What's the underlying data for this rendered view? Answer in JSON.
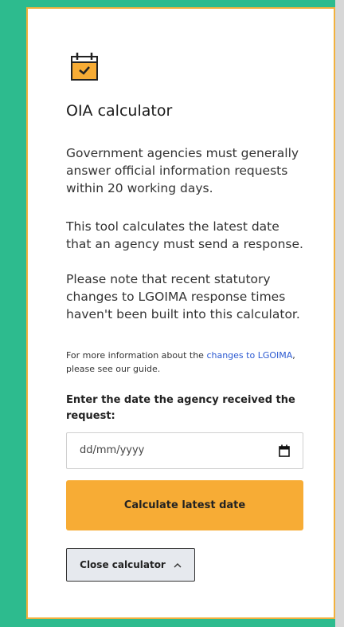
{
  "theme": {
    "background": "#2dbb8e",
    "card_border": "#f2b13d",
    "accent": "#f7ac35",
    "link": "#2b59d1"
  },
  "card": {
    "icon": "calendar-check-icon",
    "title": "OIA calculator",
    "paragraphs": [
      "Government agencies must generally answer official information requests within 20 working days.",
      "This tool calculates the latest date that an agency must send a response.",
      "Please note that recent statutory changes to LGOIMA response times haven't been built into this calculator."
    ],
    "note": {
      "before": "For more information about the ",
      "link": "changes to LGOIMA",
      "after": ", please see our guide."
    }
  },
  "form": {
    "label": "Enter the date the agency received the request:",
    "date_placeholder": "dd/mm/yyyy",
    "date_icon": "calendar-icon"
  },
  "buttons": {
    "calculate": "Calculate latest date",
    "close": "Close calculator",
    "close_icon": "chevron-up-icon"
  }
}
